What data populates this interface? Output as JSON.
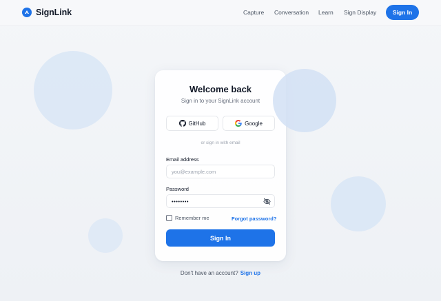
{
  "header": {
    "brand": "SignLink",
    "nav": [
      "Capture",
      "Conversation",
      "Learn",
      "Sign Display"
    ],
    "signin_label": "Sign In"
  },
  "card": {
    "title": "Welcome back",
    "subtitle": "Sign in to your SignLink account",
    "github_label": "GitHub",
    "google_label": "Google",
    "divider": "or sign in with email",
    "email_label": "Email address",
    "email_placeholder": "you@example.com",
    "password_label": "Password",
    "password_value": "••••••••",
    "remember_label": "Remember me",
    "forgot_label": "Forgot password?",
    "submit_label": "Sign In"
  },
  "footer": {
    "prompt": "Don't have an account?",
    "signup_label": "Sign up"
  },
  "colors": {
    "accent": "#1e73e8"
  },
  "icons": {
    "logo": "hand-arrow-icon",
    "github": "github-icon",
    "google": "google-icon",
    "password_toggle": "eye-off-icon"
  }
}
